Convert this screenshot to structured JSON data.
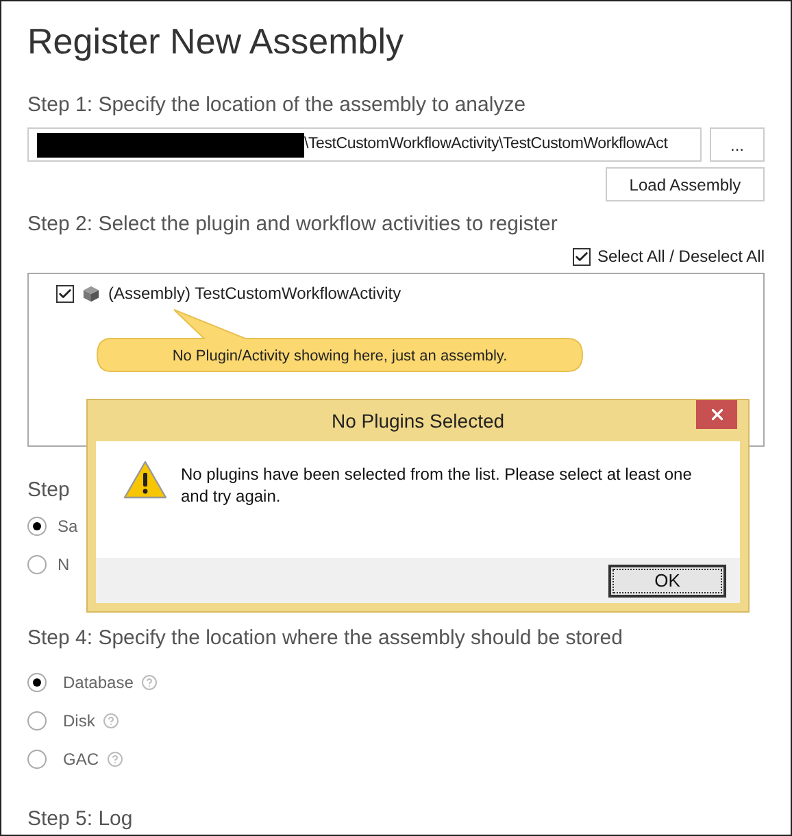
{
  "page": {
    "title": "Register New Assembly"
  },
  "step1": {
    "heading": "Step 1: Specify the location of the assembly to analyze",
    "path": "\\TestCustomWorkflowActivity\\TestCustomWorkflowAct",
    "browse_button": "...",
    "load_button": "Load Assembly"
  },
  "step2": {
    "heading": "Step 2: Select the plugin and workflow activities to register",
    "select_all": {
      "label": "Select All / Deselect All",
      "checked": true
    },
    "items": [
      {
        "label": "(Assembly) TestCustomWorkflowActivity",
        "checked": true
      }
    ]
  },
  "callout": {
    "text": "No Plugin/Activity showing here, just an assembly."
  },
  "step3": {
    "heading": "Step",
    "options": [
      {
        "label": "Sa",
        "selected": true
      },
      {
        "label": "N",
        "selected": false
      }
    ]
  },
  "step4": {
    "heading": "Step 4: Specify the location where the assembly should be stored",
    "options": [
      {
        "label": "Database",
        "selected": true
      },
      {
        "label": "Disk",
        "selected": false
      },
      {
        "label": "GAC",
        "selected": false
      }
    ]
  },
  "step5": {
    "heading": "Step 5: Log"
  },
  "dialog": {
    "title": "No Plugins Selected",
    "message": "No plugins have been selected from the list. Please select at least one and try again.",
    "button": "OK"
  }
}
